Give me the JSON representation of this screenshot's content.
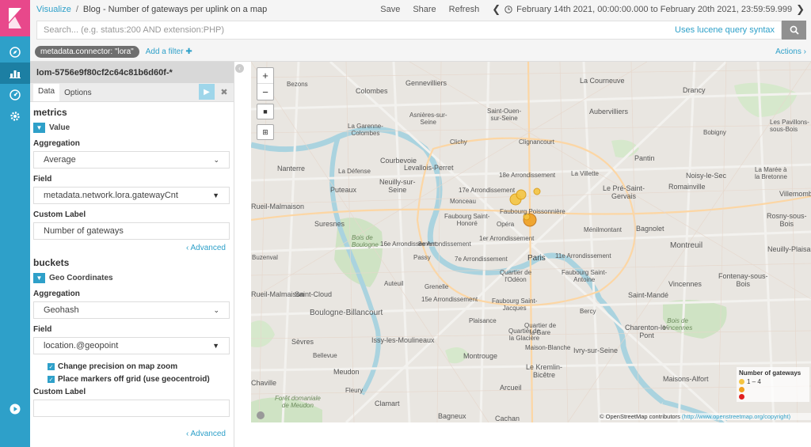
{
  "nav": {
    "items": [
      {
        "name": "discover-icon"
      },
      {
        "name": "visualize-icon"
      },
      {
        "name": "dashboard-icon"
      },
      {
        "name": "settings-icon"
      }
    ],
    "bottom": "play-circle-icon"
  },
  "topbar": {
    "crumb_link": "Visualize",
    "crumb_sep": "/",
    "title": "Blog - Number of gateways per uplink on a map",
    "save": "Save",
    "share": "Share",
    "refresh": "Refresh",
    "timerange": "February 14th 2021, 00:00:00.000 to February 20th 2021, 23:59:59.999"
  },
  "search": {
    "placeholder": "Search... (e.g. status:200 AND extension:PHP)",
    "lucene": "Uses lucene query syntax"
  },
  "filters": {
    "pill": "metadata.connector: \"lora\"",
    "add": "Add a filter",
    "actions": "Actions"
  },
  "sidebar": {
    "index": "lom-5756e9f80cf2c64c81b6d60f-*",
    "tabs": [
      "Data",
      "Options"
    ],
    "metrics_heading": "metrics",
    "metric_agg_title": "Value",
    "aggregation_label": "Aggregation",
    "metric_aggregation": "Average",
    "field_label": "Field",
    "metric_field": "metadata.network.lora.gatewayCnt",
    "custom_label_label": "Custom Label",
    "metric_custom_label": "Number of gateways",
    "advanced": "Advanced",
    "buckets_heading": "buckets",
    "bucket_agg_title": "Geo Coordinates",
    "bucket_aggregation": "Geohash",
    "bucket_field": "location.@geopoint",
    "check1": "Change precision on map zoom",
    "check2": "Place markers off grid (use geocentroid)",
    "bucket_custom_label": ""
  },
  "map": {
    "labels": {
      "la_courneuve": "La Courneuve",
      "gennevilliers": "Gennevilliers",
      "bezons": "Bezons",
      "colombes": "Colombes",
      "drancy": "Drancy",
      "saint_ouen": "Saint-Ouen-\nsur-Seine",
      "aubervilliers": "Aubervilliers",
      "asnieres": "Asnières-sur-\nSeine",
      "la_garenne": "La Garenne-\nColombes",
      "clichy": "Clichy",
      "bobigny": "Bobigny",
      "les_pavillons": "Les Pavillons-\nsous-Bois",
      "courbevoie": "Courbevoie",
      "clignancourt": "Clignancourt",
      "pantin": "Pantin",
      "nanterre": "Nanterre",
      "la_defense": "La Défense",
      "levallois": "Levallois-Perret",
      "arr18": "18e Arrondissement",
      "la_villette": "La Villette",
      "noisy": "Noisy-le-Sec",
      "la_maree": "La Marée à\nla Bretonne",
      "puteaux": "Puteaux",
      "neuilly": "Neuilly-sur-\nSeine",
      "arr17": "17e Arrondissement",
      "le_pre": "Le Pré-Saint-\nGervais",
      "romainville": "Romainville",
      "villemomble": "Villemomble",
      "rueil": "Rueil-Malmaison",
      "monceau": "Monceau",
      "faubourg_poissonniere": "Faubourg Poissonnière",
      "suresnes": "Suresnes",
      "faubourg_st_honore": "Faubourg Saint-\nHonoré",
      "opera": "Opéra",
      "menilmontant": "Ménilmontant",
      "bagnolet": "Bagnolet",
      "rosny": "Rosny-sous-\nBois",
      "bois_boulogne": "Bois de\nBoulogne",
      "arr8": "8e Arrondissement",
      "arr1": "1er Arrondissement",
      "arr16": "16e Arrondissement",
      "montreuil": "Montreuil",
      "neuilly_plaisance": "Neuilly-Plaisance",
      "buzenval": "Buzenval",
      "passy": "Passy",
      "arr7": "7e Arrondissement",
      "paris": "Paris",
      "arr11": "11e Arrondissement",
      "quartier_odeon": "Quartier de\nl'Odéon",
      "faubourg_st_antoine": "Faubourg Saint-\nAntoine",
      "fontenay": "Fontenay-sous-\nBois",
      "vincennes": "Vincennes",
      "rueil2": "Rueil-Malmaison",
      "auteuil": "Auteuil",
      "grenelle": "Grenelle",
      "saint_cloud": "Saint-Cloud",
      "saint_mande": "Saint-Mandé",
      "arr15": "15e Arrondissement",
      "boulogne": "Boulogne-Billancourt",
      "faubourg_st_jacques": "Faubourg Saint-\nJacques",
      "bercy": "Bercy",
      "plaisance": "Plaisance",
      "quartier_gare": "Quartier de\nla Gare",
      "bois_vincennes": "Bois de\nVincennes",
      "sevres": "Sèvres",
      "issy": "Issy-les-Moulineaux",
      "quartier_glaciere": "Quartier de\nla Glacière",
      "maison_blanche": "Maison-Blanche",
      "charenton": "Charenton-le-\nPont",
      "bellevue": "Bellevue",
      "montrouge": "Montrouge",
      "ivry": "Ivry-sur-Seine",
      "meudon": "Meudon",
      "kremlin": "Le Kremlin-\nBicêtre",
      "chaville": "Chaville",
      "fleury": "Fleury",
      "maisons_alfort": "Maisons-Alfort",
      "foret_meudon": "Forêt domaniale\nde Meudon",
      "clamart": "Clamart",
      "arcueil": "Arcueil",
      "bagneux": "Bagneux",
      "cachan": "Cachan"
    },
    "legend": {
      "title": "Number of gateways",
      "range": "1 – 4",
      "colors": [
        "#f5c542",
        "#f0a020",
        "#e02020"
      ]
    },
    "attribution_text": "© OpenStreetMap contributors",
    "attribution_url": "(http://www.openstreetmap.org/copyright)",
    "zoom_in": "+",
    "zoom_out": "−"
  }
}
